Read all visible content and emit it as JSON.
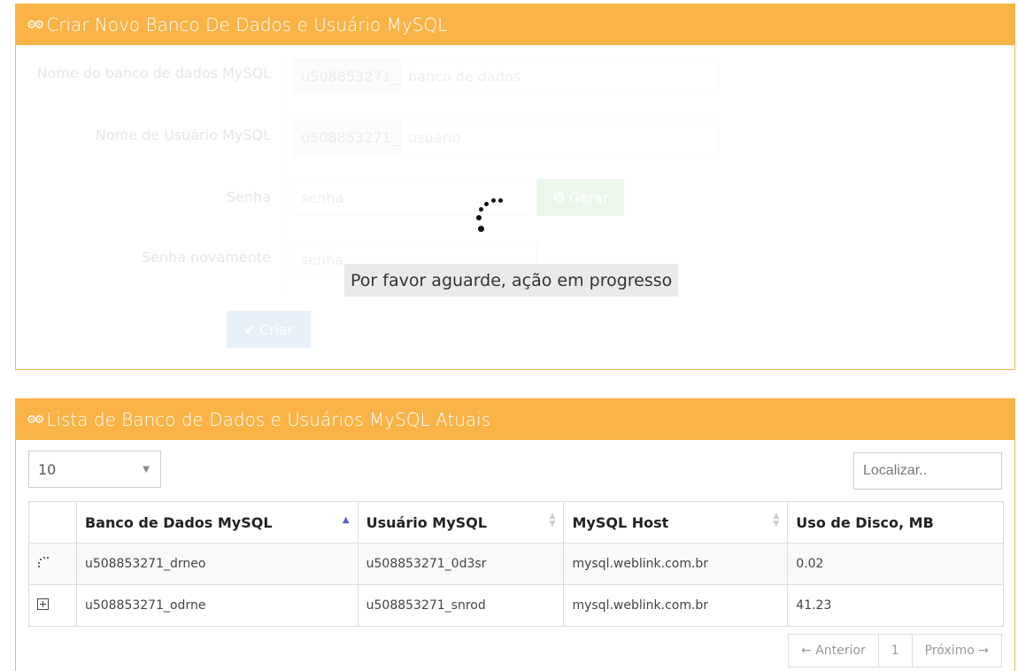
{
  "create_panel": {
    "title": "Criar Novo Banco De Dados e Usuário MySQL",
    "db_label": "Nome do banco de dados MySQL",
    "db_prefix": "u508853271_",
    "db_placeholder": "banco de dados",
    "user_label": "Nome de Usuário MySQL",
    "user_prefix": "u508853271_",
    "user_placeholder": "usuário",
    "password_label": "Senha",
    "password_placeholder": "senha",
    "generate_button": "Gerar",
    "password_again_label": "Senha novamente",
    "password_again_placeholder": "senha",
    "create_button": "Criar",
    "wait_message": "Por favor aguarde, ação em progresso"
  },
  "list_panel": {
    "title": "Lista de Banco de Dados e Usuários MySQL Atuais",
    "page_length": "10",
    "search_placeholder": "Localizar..",
    "columns": [
      "Banco de Dados MySQL",
      "Usuário MySQL",
      "MySQL Host",
      "Uso de Disco, MB"
    ],
    "rows": [
      {
        "db": "u508853271_drneo",
        "user": "u508853271_0d3sr",
        "host": "mysql.weblink.com.br",
        "disk": "0.02",
        "icon": "loading-spinner-icon"
      },
      {
        "db": "u508853271_odrne",
        "user": "u508853271_snrod",
        "host": "mysql.weblink.com.br",
        "disk": "41.23",
        "icon": "expand-plus-icon"
      }
    ],
    "pagination": {
      "previous": "← Anterior",
      "page": "1",
      "next": "Próximo →"
    }
  },
  "colors": {
    "panel_header": "#f9b347",
    "generate_button": "#5cb85c",
    "create_button": "#428bca"
  }
}
